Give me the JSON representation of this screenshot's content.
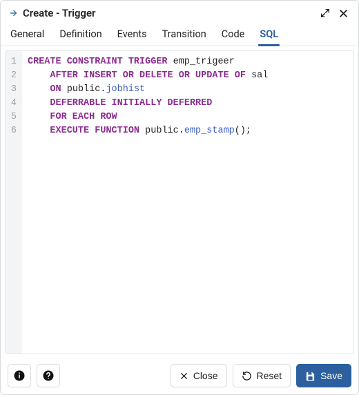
{
  "header": {
    "title": "Create - Trigger"
  },
  "tabs": [
    {
      "label": "General"
    },
    {
      "label": "Definition"
    },
    {
      "label": "Events"
    },
    {
      "label": "Transition"
    },
    {
      "label": "Code"
    },
    {
      "label": "SQL",
      "active": true
    }
  ],
  "code": {
    "lines": [
      {
        "n": "1",
        "tokens": [
          {
            "t": "CREATE CONSTRAINT TRIGGER ",
            "c": "kw"
          },
          {
            "t": "emp_trigeer",
            "c": "ident"
          }
        ]
      },
      {
        "n": "2",
        "tokens": [
          {
            "t": "    ",
            "c": ""
          },
          {
            "t": "AFTER INSERT OR DELETE OR UPDATE OF ",
            "c": "kw"
          },
          {
            "t": "sal",
            "c": "ident"
          }
        ]
      },
      {
        "n": "3",
        "tokens": [
          {
            "t": "    ",
            "c": ""
          },
          {
            "t": "ON ",
            "c": "kw"
          },
          {
            "t": "public",
            "c": "schema"
          },
          {
            "t": ".",
            "c": "punct"
          },
          {
            "t": "jobhist",
            "c": "obj"
          }
        ]
      },
      {
        "n": "4",
        "tokens": [
          {
            "t": "    ",
            "c": ""
          },
          {
            "t": "DEFERRABLE INITIALLY DEFERRED",
            "c": "kw"
          }
        ]
      },
      {
        "n": "5",
        "tokens": [
          {
            "t": "    ",
            "c": ""
          },
          {
            "t": "FOR EACH ROW",
            "c": "kw"
          }
        ]
      },
      {
        "n": "6",
        "tokens": [
          {
            "t": "    ",
            "c": ""
          },
          {
            "t": "EXECUTE FUNCTION ",
            "c": "kw"
          },
          {
            "t": "public",
            "c": "schema"
          },
          {
            "t": ".",
            "c": "punct"
          },
          {
            "t": "emp_stamp",
            "c": "obj"
          },
          {
            "t": "();",
            "c": "punct"
          }
        ]
      }
    ]
  },
  "footer": {
    "close_label": "Close",
    "reset_label": "Reset",
    "save_label": "Save"
  }
}
